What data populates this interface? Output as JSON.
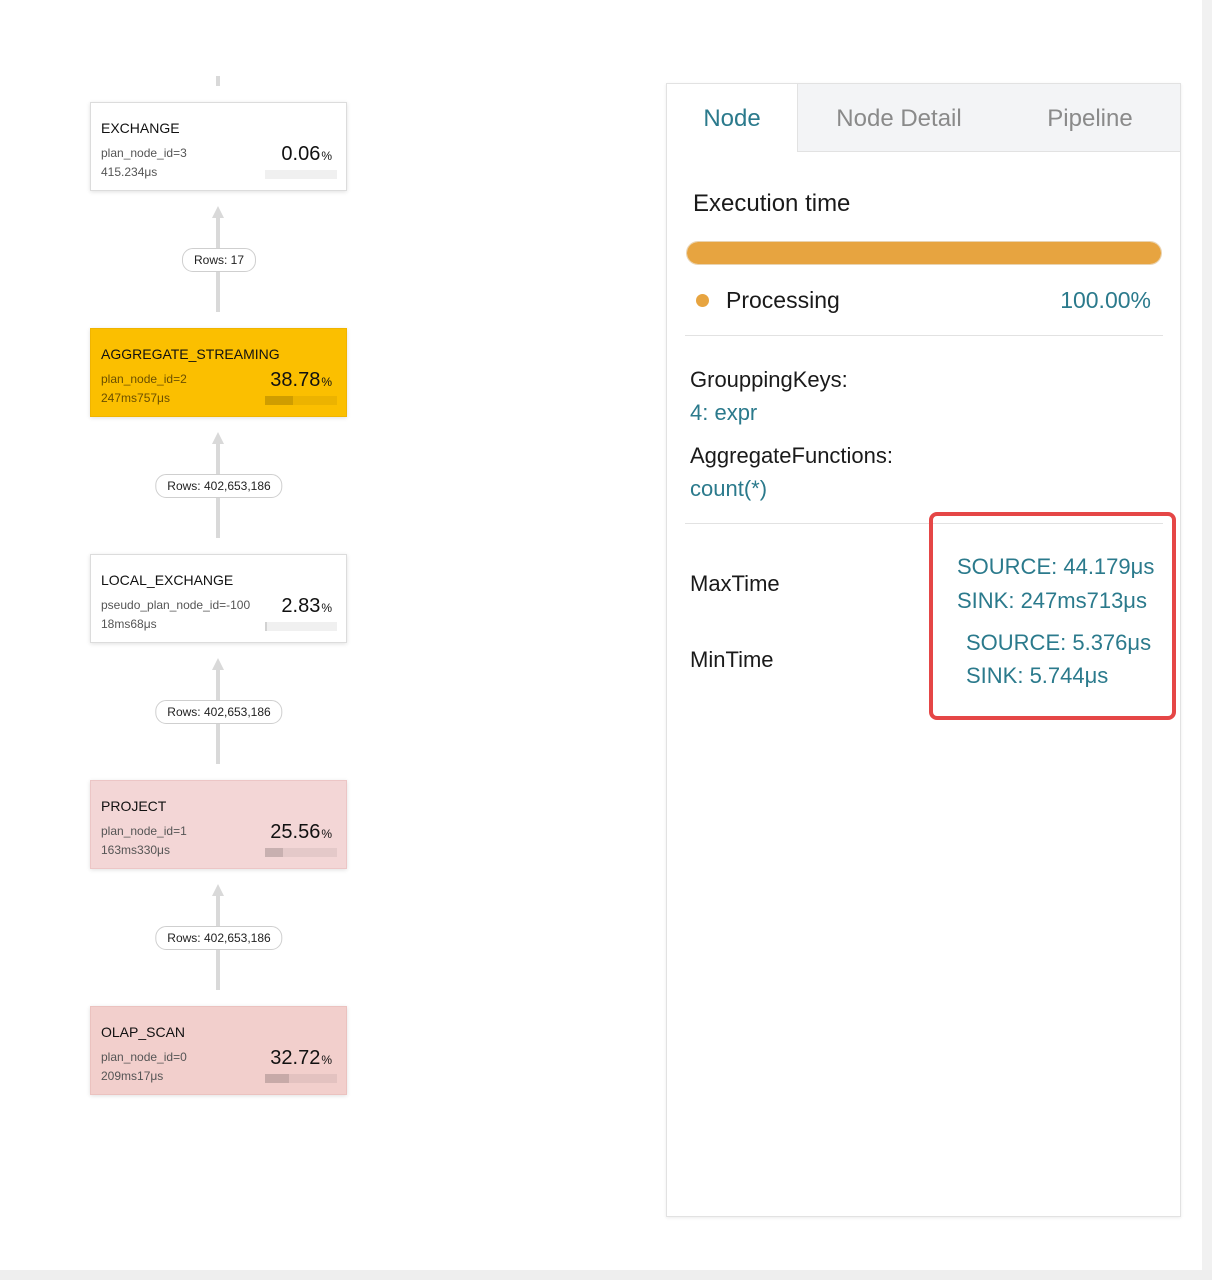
{
  "tree": {
    "nodes": [
      {
        "name": "EXCHANGE",
        "id": "plan_node_id=3",
        "time": "415.234μs",
        "pct": "0.06",
        "pct_fraction": 0.0006,
        "style": "normal"
      },
      {
        "name": "AGGREGATE_STREAMING",
        "id": "plan_node_id=2",
        "time": "247ms757μs",
        "pct": "38.78",
        "pct_fraction": 0.3878,
        "style": "hot"
      },
      {
        "name": "LOCAL_EXCHANGE",
        "id": "pseudo_plan_node_id=-100",
        "time": "18ms68μs",
        "pct": "2.83",
        "pct_fraction": 0.0283,
        "style": "normal"
      },
      {
        "name": "PROJECT",
        "id": "plan_node_id=1",
        "time": "163ms330μs",
        "pct": "25.56",
        "pct_fraction": 0.2556,
        "style": "warm"
      },
      {
        "name": "OLAP_SCAN",
        "id": "plan_node_id=0",
        "time": "209ms17μs",
        "pct": "32.72",
        "pct_fraction": 0.3272,
        "style": "warmer"
      }
    ],
    "pct_sign": "%",
    "edges": [
      {
        "rows": "Rows: 17"
      },
      {
        "rows": "Rows: 402,653,186"
      },
      {
        "rows": "Rows: 402,653,186"
      },
      {
        "rows": "Rows: 402,653,186"
      }
    ]
  },
  "panel": {
    "tabs": [
      {
        "label": "Node",
        "active": true
      },
      {
        "label": "Node Detail",
        "active": false
      },
      {
        "label": "Pipeline",
        "active": false
      }
    ],
    "execution": {
      "title": "Execution time",
      "legend_label": "Processing",
      "legend_value": "100.00%",
      "bar_fraction": 1.0,
      "bar_color": "#e7a440"
    },
    "grouping_keys_label": "GrouppingKeys:",
    "grouping_keys_value": "4: expr",
    "aggregate_functions_label": "AggregateFunctions:",
    "aggregate_functions_value": "count(*)",
    "max_time": {
      "label": "MaxTime",
      "source": "SOURCE: 44.179μs",
      "sink": "SINK: 247ms713μs"
    },
    "min_time": {
      "label": "MinTime",
      "source": "SOURCE: 5.376μs",
      "sink": "SINK: 5.744μs"
    },
    "accent_color": "#2b7a8c",
    "highlight_color": "#e54646"
  }
}
